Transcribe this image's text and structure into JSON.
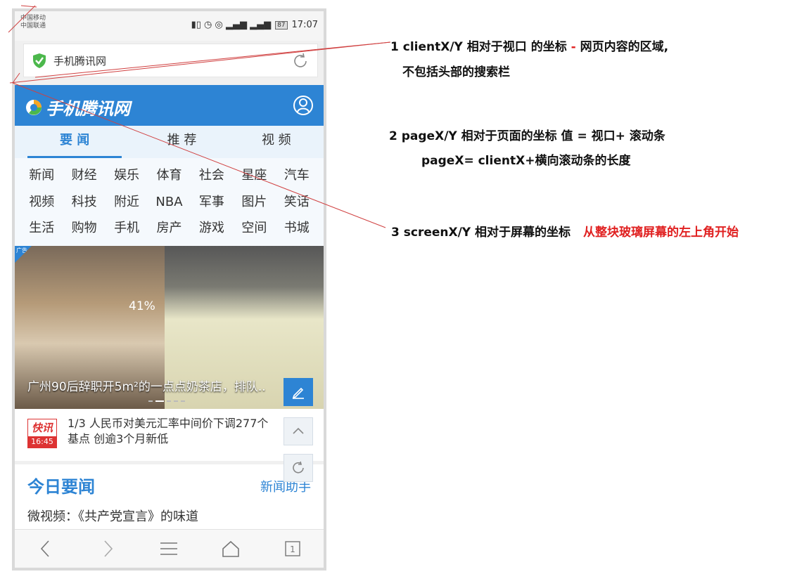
{
  "status": {
    "carrier1": "中国移动",
    "carrier2": "中国联通",
    "battery": "87",
    "time": "17:07"
  },
  "urlbar": {
    "site": "手机腾讯网"
  },
  "header": {
    "logo": "手机腾讯网"
  },
  "tabs": [
    "要 闻",
    "推 荐",
    "视 频"
  ],
  "categories": [
    "新闻",
    "财经",
    "娱乐",
    "体育",
    "社会",
    "星座",
    "汽车",
    "视频",
    "科技",
    "附近",
    "NBA",
    "军事",
    "图片",
    "笑话",
    "生活",
    "购物",
    "手机",
    "房产",
    "游戏",
    "空间",
    "书城"
  ],
  "banner": {
    "ad": "广告",
    "percent": "41%",
    "caption": "广州90后辞职开5m²的一点点奶茶店，排队.."
  },
  "flash": {
    "label": "快讯",
    "time": "16:45",
    "text": "1/3  人民币对美元汇率中间价下调277个基点 创逾3个月新低"
  },
  "today": {
    "title": "今日要闻",
    "more": "新闻助手",
    "item": "微视频：《共产党宣言》的味道"
  },
  "bottom": {
    "tab_count": "1"
  },
  "annotations": {
    "n1a": "1 clientX/Y 相对于视口 的坐标",
    "n1dash": " - ",
    "n1b": "网页内容的区域,",
    "n1c": "不包括头部的搜索栏",
    "n2a": "2 pageX/Y 相对于页面的坐标  值 = 视口+ 滚动条",
    "n2b": "pageX= clientX+横向滚动条的长度",
    "n3a": "3 screenX/Y 相对于屏幕的坐标",
    "n3b": "从整块玻璃屏幕的左上角开始"
  },
  "colors": {
    "accent": "#2d84d4",
    "annotation_red": "#e02020"
  }
}
